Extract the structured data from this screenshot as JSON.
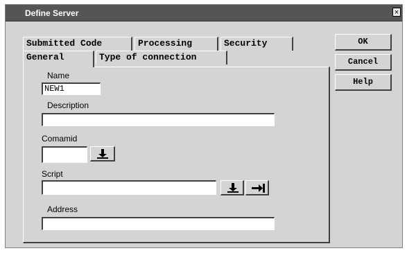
{
  "window": {
    "title": "Define Server",
    "close_glyph": "×"
  },
  "tabs": {
    "row1": [
      "Submitted Code",
      "Processing",
      "Security"
    ],
    "row2": [
      "General",
      "Type of connection"
    ],
    "active": "General"
  },
  "form": {
    "name": {
      "label": "Name",
      "value": "NEW1"
    },
    "description": {
      "label": "Description",
      "value": ""
    },
    "comamid": {
      "label": "Comamid",
      "value": "",
      "browse_icon": "browse-down-icon"
    },
    "script": {
      "label": "Script",
      "value": "",
      "browse_icon": "browse-down-icon",
      "goto_icon": "arrow-to-bar-icon"
    },
    "address": {
      "label": "Address",
      "value": ""
    }
  },
  "buttons": {
    "ok": "OK",
    "cancel": "Cancel",
    "help": "Help"
  },
  "colors": {
    "dialog_bg": "#d4d4d4",
    "titlebar_bg": "#555555",
    "field_bg": "#ffffff"
  }
}
